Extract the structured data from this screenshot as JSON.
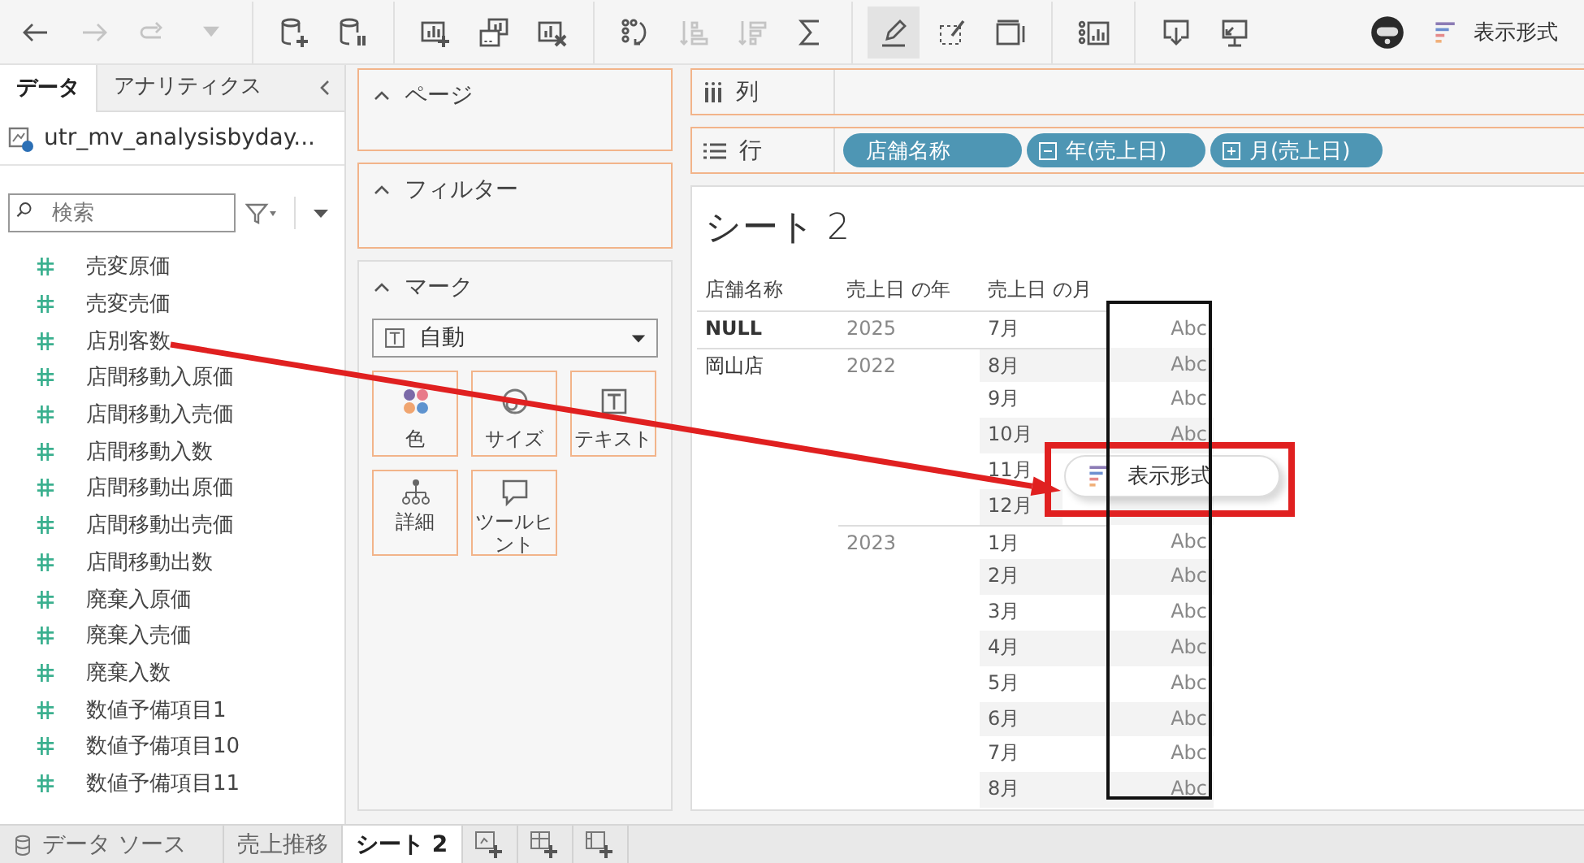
{
  "toolbar": {
    "groups": [
      {
        "buttons": [
          {
            "disabled": false,
            "pressed": false
          },
          {
            "disabled": true,
            "pressed": false
          },
          {
            "disabled": true,
            "pressed": false
          },
          {
            "disabled": true,
            "pressed": false
          }
        ]
      },
      {
        "buttons": [
          {
            "disabled": false,
            "pressed": false
          },
          {
            "disabled": false,
            "pressed": false
          }
        ]
      },
      {
        "buttons": [
          {
            "disabled": false,
            "pressed": false
          },
          {
            "disabled": false,
            "pressed": false
          },
          {
            "disabled": false,
            "pressed": false
          }
        ]
      },
      {
        "buttons": [
          {
            "disabled": false,
            "pressed": false
          },
          {
            "disabled": true,
            "pressed": false
          },
          {
            "disabled": true,
            "pressed": false
          },
          {
            "disabled": false,
            "pressed": false
          }
        ]
      },
      {
        "buttons": [
          {
            "disabled": false,
            "pressed": true
          },
          {
            "disabled": false,
            "pressed": false
          },
          {
            "disabled": false,
            "pressed": false
          }
        ]
      },
      {
        "buttons": [
          {
            "disabled": false,
            "pressed": false
          }
        ]
      },
      {
        "buttons": [
          {
            "disabled": false,
            "pressed": false
          },
          {
            "disabled": false,
            "pressed": false
          }
        ]
      }
    ],
    "format_button": {
      "label": "表示形式"
    }
  },
  "data_pane": {
    "tabs": [
      {
        "label": "データ",
        "selected": true
      },
      {
        "label": "アナリティクス",
        "selected": false
      }
    ],
    "datasource": "utr_mv_analysisbyday...",
    "search": {
      "placeholder": "検索"
    },
    "fields": [
      {
        "name": "売変原価"
      },
      {
        "name": "売変売価"
      },
      {
        "name": "店別客数"
      },
      {
        "name": "店間移動入原価"
      },
      {
        "name": "店間移動入売価"
      },
      {
        "name": "店間移動入数"
      },
      {
        "name": "店間移動出原価"
      },
      {
        "name": "店間移動出売価"
      },
      {
        "name": "店間移動出数"
      },
      {
        "name": "廃棄入原価"
      },
      {
        "name": "廃棄入売価"
      },
      {
        "name": "廃棄入数"
      },
      {
        "name": "数値予備項目1"
      },
      {
        "name": "数値予備項目10"
      },
      {
        "name": "数値予備項目11"
      }
    ]
  },
  "cards": {
    "pages": {
      "title": "ページ"
    },
    "filters": {
      "title": "フィルター"
    },
    "marks": {
      "title": "マーク",
      "mark_type": "自動",
      "buttons": [
        {
          "label": "色"
        },
        {
          "label": "サイズ"
        },
        {
          "label": "テキスト"
        },
        {
          "label": "詳細"
        },
        {
          "label": "ツールヒント"
        }
      ]
    }
  },
  "columns_shelf": {
    "label": "列"
  },
  "rows_shelf": {
    "label": "行",
    "pills": [
      {
        "label": "店舗名称",
        "kind": "plain"
      },
      {
        "label": "年(売上日)",
        "kind": "date",
        "expanded": true
      },
      {
        "label": "月(売上日)",
        "kind": "date",
        "expanded": false
      }
    ]
  },
  "sheet": {
    "title": "シート 2",
    "headers": [
      "店舗名称",
      "売上日 の年",
      "売上日 の月"
    ],
    "stores": [
      {
        "name": "NULL",
        "years": [
          {
            "year": "2025",
            "months": [
              {
                "label": "7月",
                "value": "Abc"
              }
            ]
          }
        ]
      },
      {
        "name": "岡山店",
        "years": [
          {
            "year": "2022",
            "months": [
              {
                "label": "8月",
                "value": "Abc"
              },
              {
                "label": "9月",
                "value": "Abc"
              },
              {
                "label": "10月",
                "value": "Abc"
              },
              {
                "label": "11月"
              },
              {
                "label": "12月"
              }
            ]
          },
          {
            "year": "2023",
            "months": [
              {
                "label": "1月",
                "value": "Abc"
              },
              {
                "label": "2月",
                "value": "Abc"
              },
              {
                "label": "3月",
                "value": "Abc"
              },
              {
                "label": "4月",
                "value": "Abc"
              },
              {
                "label": "5月",
                "value": "Abc"
              },
              {
                "label": "6月",
                "value": "Abc"
              },
              {
                "label": "7月",
                "value": "Abc"
              },
              {
                "label": "8月",
                "value": "Abc"
              }
            ]
          }
        ]
      }
    ]
  },
  "drag_popup": {
    "label": "表示形式"
  },
  "annotations": [
    {
      "kind": "arrow",
      "color": "#e02020"
    },
    {
      "kind": "frame",
      "color": "#e02020"
    },
    {
      "kind": "frame",
      "color": "#111111"
    }
  ],
  "sheet_tabs": {
    "data_source": "データ ソース",
    "tabs": [
      {
        "label": "売上推移",
        "selected": false
      },
      {
        "label": "シート 2",
        "selected": true
      }
    ]
  }
}
